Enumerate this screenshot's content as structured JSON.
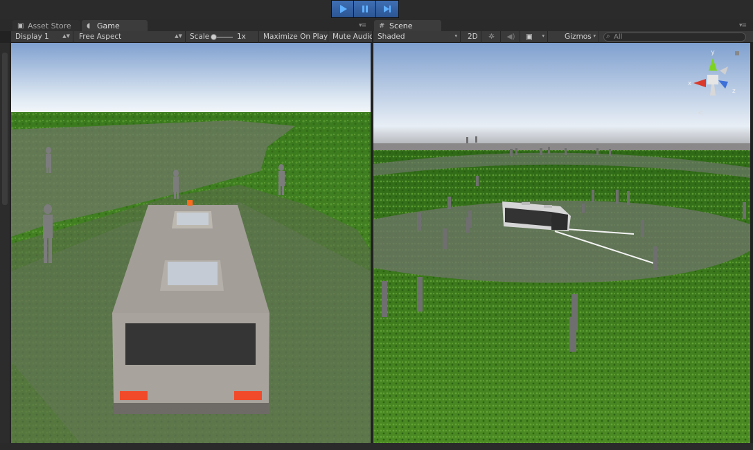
{
  "playbar": {
    "play": "play-icon",
    "pause": "pause-icon",
    "step": "step-icon"
  },
  "left_panel": {
    "tabs": [
      {
        "label": "Asset Store",
        "icon": "shopping-bag-icon"
      },
      {
        "label": "Game",
        "icon": "pacman-icon"
      }
    ],
    "toolbar": {
      "display": "Display 1",
      "aspect": "Free Aspect",
      "scale_label": "Scale",
      "scale_value": "1x",
      "maximize": "Maximize On Play",
      "mute": "Mute Audio"
    }
  },
  "right_panel": {
    "tabs": [
      {
        "label": "Scene",
        "icon": "grid-icon"
      }
    ],
    "toolbar": {
      "shading": "Shaded",
      "mode_2d": "2D",
      "gizmos": "Gizmos",
      "search_placeholder": "All"
    },
    "gizmo": {
      "x": "x",
      "y": "y",
      "z": "z",
      "projection": "<"
    }
  },
  "colors": {
    "editor_dark": "#2a2a2a",
    "toolbar": "#3a3a3a",
    "play_active": "#3f6fb5",
    "grass": "#3f7a22",
    "path": "#6f7866",
    "sky_top": "#7fa0cf",
    "sky_bottom": "#ffffff"
  }
}
